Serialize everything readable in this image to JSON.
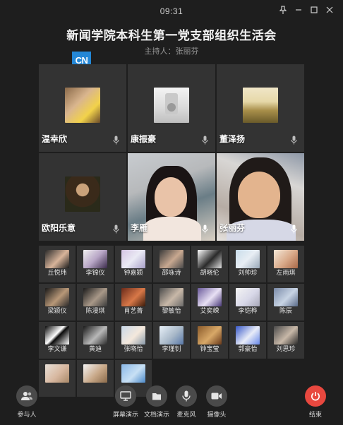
{
  "window": {
    "time": "09:31",
    "controls": [
      "pin-icon",
      "minimize-icon",
      "maximize-icon",
      "close-icon"
    ]
  },
  "meeting": {
    "title": "新闻学院本科生第一党支部组织生活会",
    "host": "主持人：张丽芬"
  },
  "logo": {
    "text": "CN",
    "color": "#2487d6"
  },
  "main_participants": [
    {
      "name": "温幸欣"
    },
    {
      "name": "康振豪"
    },
    {
      "name": "董泽扬"
    },
    {
      "name": "欧阳乐意"
    },
    {
      "name": "李雁"
    },
    {
      "name": "张丽芬"
    }
  ],
  "participants": [
    {
      "name": "丘悦玮"
    },
    {
      "name": "李锦仪"
    },
    {
      "name": "钟嘉颖"
    },
    {
      "name": "邵咏诗"
    },
    {
      "name": "胡晓伦"
    },
    {
      "name": "刘帅珍"
    },
    {
      "name": "左雨琪"
    },
    {
      "name": "梁颖仪"
    },
    {
      "name": "陈漫琪"
    },
    {
      "name": "肖艺菁"
    },
    {
      "name": "黎敏怡"
    },
    {
      "name": "艾奕嵘"
    },
    {
      "name": "李铠桦"
    },
    {
      "name": "陈辰"
    },
    {
      "name": "李文谦"
    },
    {
      "name": "黄迪"
    },
    {
      "name": "张晓怡"
    },
    {
      "name": "李瑾钊"
    },
    {
      "name": "钟宝莹"
    },
    {
      "name": "郭豪怡"
    },
    {
      "name": "刘思珍"
    },
    {
      "name": ""
    },
    {
      "name": ""
    },
    {
      "name": ""
    }
  ],
  "toolbar": {
    "participants": "参与人",
    "screen_share": "屏幕演示",
    "doc_share": "文档演示",
    "mic": "麦克风",
    "camera": "摄像头",
    "end": "结束"
  },
  "colors": {
    "end_button": "#e8483f",
    "background": "#1e1e1e",
    "tile": "#333333"
  }
}
